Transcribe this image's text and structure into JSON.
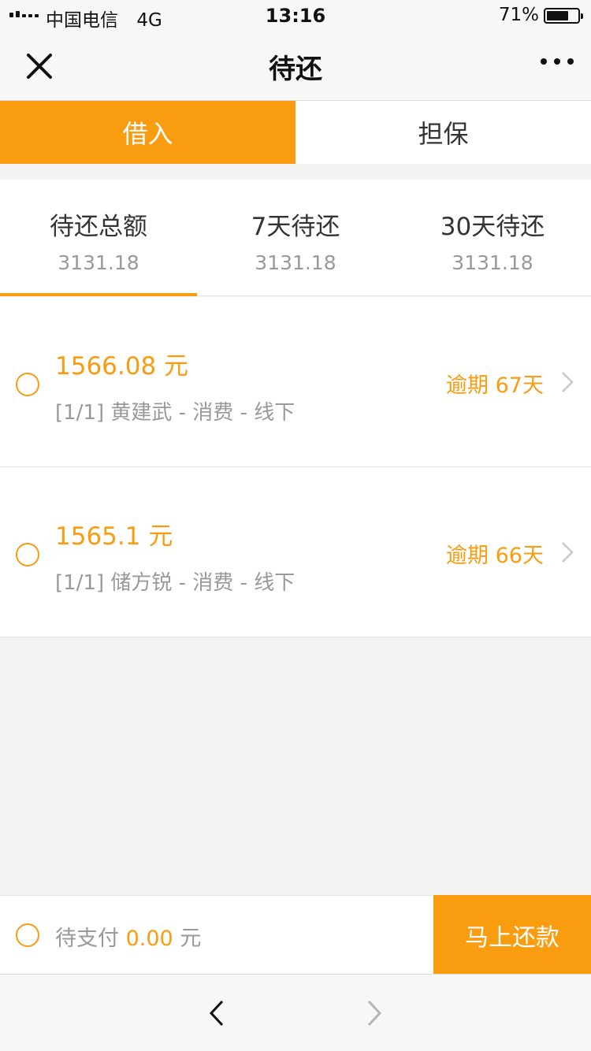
{
  "status_bar": {
    "carrier": "中国电信",
    "network": "4G",
    "time": "13:16",
    "battery_percent_text": "71%",
    "battery_level": 0.71
  },
  "nav": {
    "title": "待还",
    "close_icon": "close-icon",
    "more_icon": "more-dots-icon"
  },
  "tabs": [
    {
      "label": "借入",
      "active": true
    },
    {
      "label": "担保",
      "active": false
    }
  ],
  "summary": [
    {
      "label": "待还总额",
      "value": "3131.18",
      "active": true
    },
    {
      "label": "7天待还",
      "value": "3131.18",
      "active": false
    },
    {
      "label": "30天待还",
      "value": "3131.18",
      "active": false
    }
  ],
  "loans": [
    {
      "amount": "1566.08 元",
      "desc": "[1/1] 黄建武 - 消费 - 线下",
      "status": "逾期 67天"
    },
    {
      "amount": "1565.1 元",
      "desc": "[1/1] 储方锐 - 消费 - 线下",
      "status": "逾期 66天"
    }
  ],
  "pay_bar": {
    "label": "待支付",
    "amount": "0.00",
    "unit": "元",
    "button": "马上还款"
  },
  "colors": {
    "accent": "#f99c10",
    "background": "#f3f3f3"
  }
}
